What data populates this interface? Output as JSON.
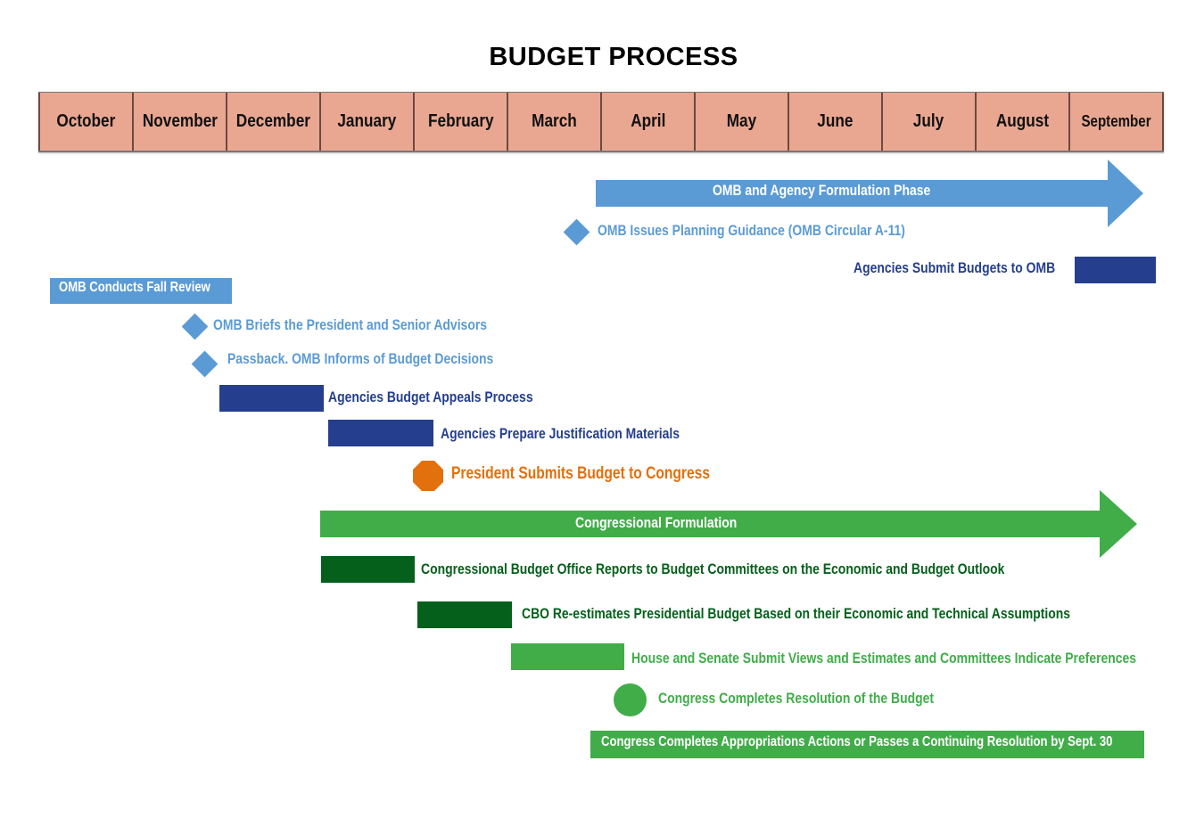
{
  "title": "BUDGET PROCESS",
  "months": [
    "October",
    "November",
    "December",
    "January",
    "February",
    "March",
    "April",
    "May",
    "June",
    "July",
    "August",
    "September"
  ],
  "colors": {
    "month_fill": "#e9a791",
    "omb_light_blue": "#5b9bd5",
    "agency_dark_blue": "#253f8e",
    "president_orange": "#e2700c",
    "congress_green": "#41ad49",
    "cbo_dark_green": "#05601b"
  },
  "phases": {
    "omb_formulation": {
      "label": "OMB and Agency Formulation Phase",
      "start_month": "April",
      "end_month": "September"
    },
    "congressional_formulation": {
      "label": "Congressional Formulation",
      "start_month": "January",
      "end_month": "September"
    }
  },
  "events": {
    "omb_planning_guidance": {
      "label": "OMB Issues Planning Guidance (OMB Circular A-11)",
      "marker": "diamond",
      "month": "March/April"
    },
    "agencies_submit": {
      "label": "Agencies Submit Budgets to OMB",
      "marker": "bar",
      "month": "September"
    },
    "fall_review": {
      "label": "OMB Conducts Fall Review",
      "marker": "bar",
      "start_month": "October",
      "end_month": "December"
    },
    "briefs_president": {
      "label": "OMB Briefs the President and Senior Advisors",
      "marker": "diamond",
      "month": "November/December"
    },
    "passback": {
      "label": "Passback. OMB Informs of Budget Decisions",
      "marker": "diamond",
      "month": "December"
    },
    "appeals": {
      "label": "Agencies Budget Appeals Process",
      "marker": "bar",
      "month": "December"
    },
    "justification": {
      "label": "Agencies Prepare Justification Materials",
      "marker": "bar",
      "month": "January"
    },
    "president_submits": {
      "label": "President Submits Budget to Congress",
      "marker": "octagon",
      "month": "February"
    },
    "cbo_reports": {
      "label": "Congressional Budget Office Reports to Budget Committees on the Economic and Budget Outlook",
      "marker": "bar",
      "month": "January"
    },
    "cbo_reestimates": {
      "label": "CBO Re-estimates Presidential Budget Based on their Economic and Technical Assumptions",
      "marker": "bar",
      "month": "February"
    },
    "views_estimates": {
      "label": "House and Senate Submit Views and Estimates and Committees Indicate Preferences",
      "marker": "bar",
      "month": "March"
    },
    "resolution": {
      "label": "Congress Completes Resolution of the Budget",
      "marker": "circle",
      "month": "April"
    },
    "appropriations": {
      "label": "Congress Completes Appropriations Actions or Passes a Continuing Resolution by Sept. 30",
      "marker": "bar",
      "start_month": "April",
      "end_month": "September"
    }
  }
}
